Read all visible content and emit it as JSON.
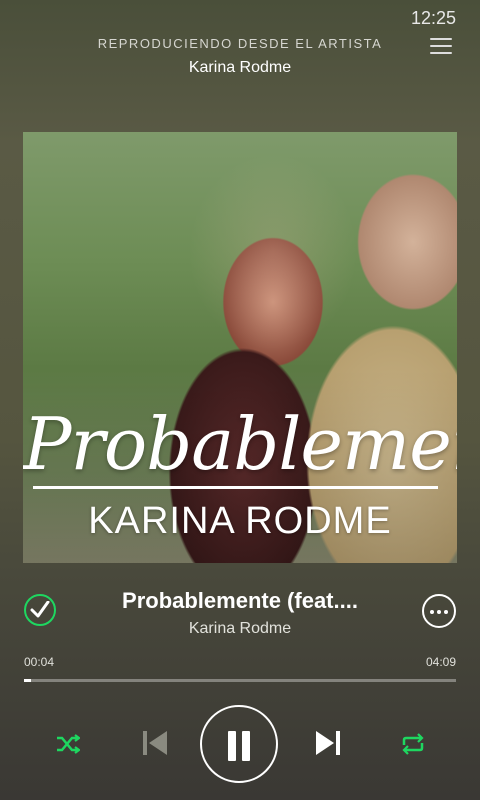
{
  "status_bar": {
    "time": "12:25"
  },
  "header": {
    "context_title": "REPRODUCIENDO DESDE EL ARTISTA",
    "context_name": "Karina Rodme",
    "menu_icon": "hamburger-menu-icon"
  },
  "cover": {
    "script_title": "Probablemente",
    "artist_text": "KARINA RODME"
  },
  "track": {
    "title": "Probablemente (feat....",
    "artist": "Karina Rodme",
    "saved": true,
    "saved_icon": "check-circle-icon",
    "more_icon": "more-options-icon"
  },
  "progress": {
    "elapsed": "00:04",
    "total": "04:09",
    "fraction": 0.016
  },
  "controls": {
    "shuffle_icon": "shuffle-icon",
    "previous_icon": "skip-previous-icon",
    "play_pause_icon": "pause-icon",
    "next_icon": "skip-next-icon",
    "repeat_icon": "repeat-icon"
  },
  "colors": {
    "accent": "#1ed760",
    "prev_disabled": "#8a8a80"
  }
}
